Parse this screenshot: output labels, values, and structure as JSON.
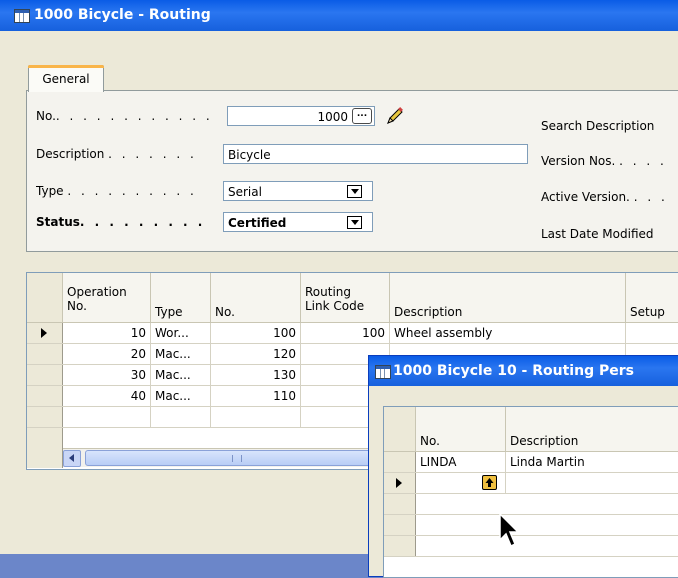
{
  "main_window": {
    "title": "1000 Bicycle - Routing",
    "tab": "General",
    "fields": {
      "no_label": "No.",
      "no_value": "1000",
      "assist_button": "...",
      "description_label": "Description",
      "description_value": "Bicycle",
      "type_label": "Type",
      "type_value": "Serial",
      "status_label": "Status",
      "status_value": "Certified",
      "search_description_label": "Search Description",
      "version_nos_label": "Version Nos.",
      "active_version_label": "Active Version.",
      "last_date_modified_label": "Last Date Modified"
    },
    "dot_leaders": {
      "no": ". . . . . . . . . . . .",
      "description": ". . . . . . .",
      "type": ". . . . . . . . . .",
      "status": ". . . . . . . . .",
      "version": ". . . .",
      "active": ". . ."
    },
    "columns": {
      "operation_no_1": "Operation",
      "operation_no_2": "No.",
      "type": "Type",
      "no": "No.",
      "routing_link_code_1": "Routing",
      "routing_link_code_2": "Link Code",
      "description": "Description",
      "setup": "Setup"
    },
    "rows": [
      {
        "operation_no": "10",
        "type": "Wor...",
        "no": "100",
        "routing_link_code": "100",
        "description": "Wheel assembly"
      },
      {
        "operation_no": "20",
        "type": "Mac...",
        "no": "120",
        "routing_link_code": "",
        "description": ""
      },
      {
        "operation_no": "30",
        "type": "Mac...",
        "no": "130",
        "routing_link_code": "",
        "description": ""
      },
      {
        "operation_no": "40",
        "type": "Mac...",
        "no": "110",
        "routing_link_code": "1",
        "description": ""
      }
    ]
  },
  "sub_window": {
    "title": "1000 Bicycle 10 - Routing Pers",
    "columns": {
      "no": "No.",
      "description": "Description"
    },
    "rows": [
      {
        "no": "LINDA",
        "description": "Linda Martin"
      }
    ]
  },
  "icons": [
    "window-icon",
    "pencil-icon",
    "dropdown-arrow-icon",
    "lookup-up-arrow-icon",
    "scroll-left-icon",
    "row-pointer-icon",
    "mouse-cursor-icon"
  ]
}
